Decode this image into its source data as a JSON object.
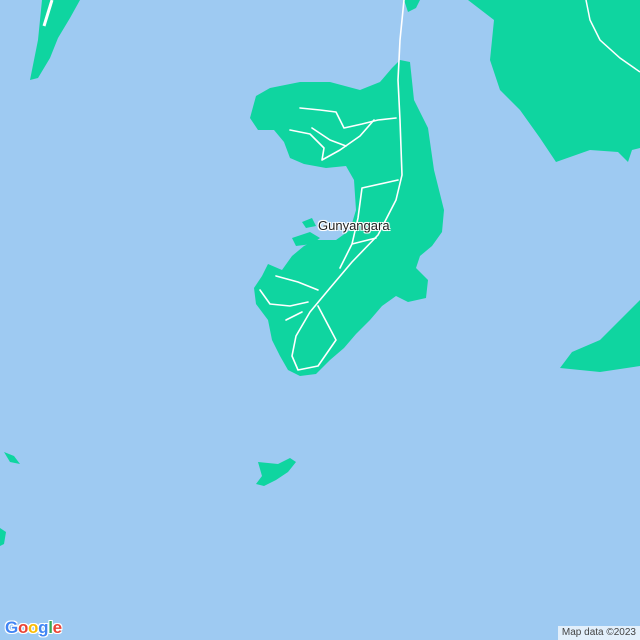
{
  "map": {
    "colors": {
      "water": "#9ecaf2",
      "land": "#0fd5a0",
      "road": "#ffffff"
    },
    "place_label": "Gunyangara",
    "logo": "Google",
    "logo_colors": [
      "#4285F4",
      "#EA4335",
      "#FBBC05",
      "#4285F4",
      "#34A853",
      "#EA4335"
    ],
    "attribution": "Map data ©2023"
  }
}
